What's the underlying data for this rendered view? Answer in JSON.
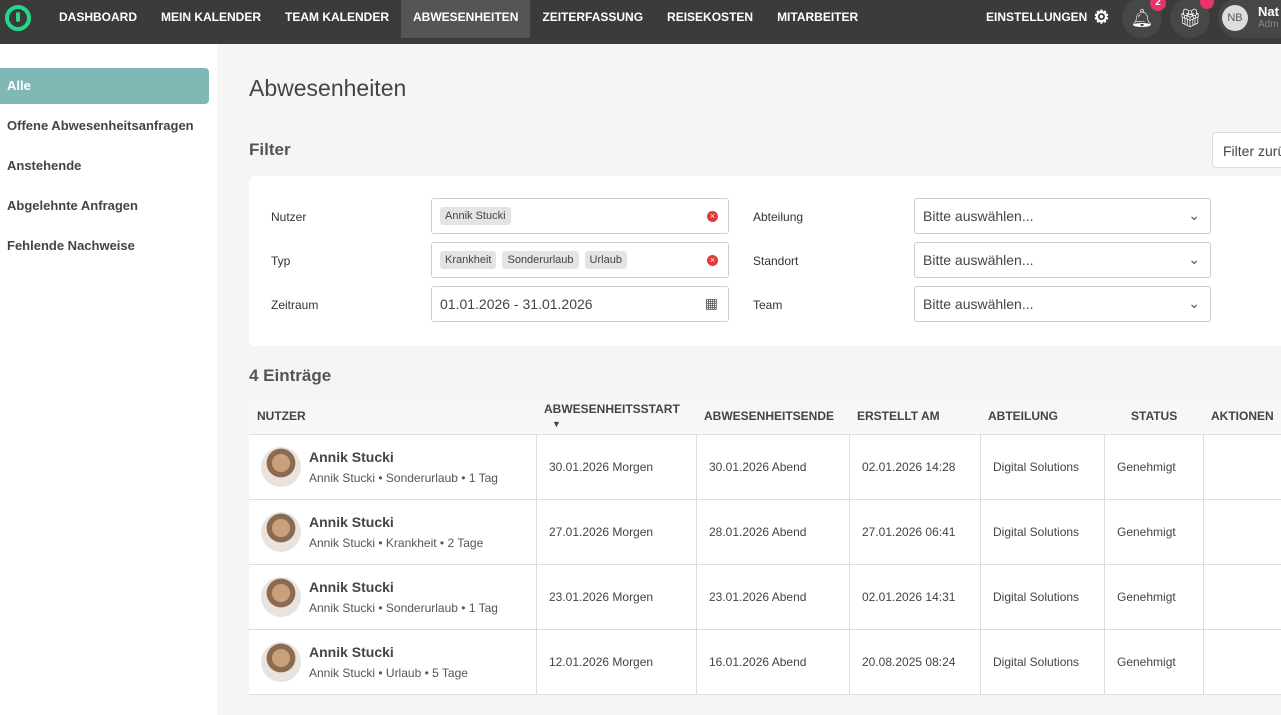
{
  "nav": {
    "items": [
      "DASHBOARD",
      "MEIN KALENDER",
      "TEAM KALENDER",
      "ABWESENHEITEN",
      "ZEITERFASSUNG",
      "REISEKOSTEN",
      "MITARBEITER"
    ],
    "settings": "EINSTELLUNGEN",
    "notifications": "2",
    "user_initials": "NB",
    "user_name": "Nat",
    "user_role": "Adm"
  },
  "sidebar": [
    "Alle",
    "Offene Abwesenheitsanfragen",
    "Anstehende",
    "Abgelehnte Anfragen",
    "Fehlende Nachweise"
  ],
  "title": "Abwesenheiten",
  "filter": {
    "title": "Filter",
    "reset": "Filter zurü",
    "nutzer_label": "Nutzer",
    "nutzer_chips": [
      "Annik Stucki"
    ],
    "typ_label": "Typ",
    "typ_chips": [
      "Krankheit",
      "Sonderurlaub",
      "Urlaub"
    ],
    "zeitraum_label": "Zeitraum",
    "zeitraum": "01.01.2026 - 31.01.2026",
    "abteilung_label": "Abteilung",
    "standort_label": "Standort",
    "team_label": "Team",
    "placeholder": "Bitte auswählen..."
  },
  "count": "4 Einträge",
  "columns": [
    "NUTZER",
    "ABWESENHEITSSTART",
    "ABWESENHEITSENDE",
    "ERSTELLT AM",
    "ABTEILUNG",
    "STATUS",
    "AKTIONEN"
  ],
  "rows": [
    {
      "name": "Annik Stucki",
      "sub": "Annik Stucki • Sonderurlaub • 1 Tag",
      "start": "30.01.2026 Morgen",
      "end": "30.01.2026 Abend",
      "created": "02.01.2026 14:28",
      "dept": "Digital Solutions",
      "status": "Genehmigt"
    },
    {
      "name": "Annik Stucki",
      "sub": "Annik Stucki • Krankheit • 2 Tage",
      "start": "27.01.2026 Morgen",
      "end": "28.01.2026 Abend",
      "created": "27.01.2026 06:41",
      "dept": "Digital Solutions",
      "status": "Genehmigt"
    },
    {
      "name": "Annik Stucki",
      "sub": "Annik Stucki • Sonderurlaub • 1 Tag",
      "start": "23.01.2026 Morgen",
      "end": "23.01.2026 Abend",
      "created": "02.01.2026 14:31",
      "dept": "Digital Solutions",
      "status": "Genehmigt"
    },
    {
      "name": "Annik Stucki",
      "sub": "Annik Stucki • Urlaub • 5 Tage",
      "start": "12.01.2026 Morgen",
      "end": "16.01.2026 Abend",
      "created": "20.08.2025 08:24",
      "dept": "Digital Solutions",
      "status": "Genehmigt"
    }
  ]
}
